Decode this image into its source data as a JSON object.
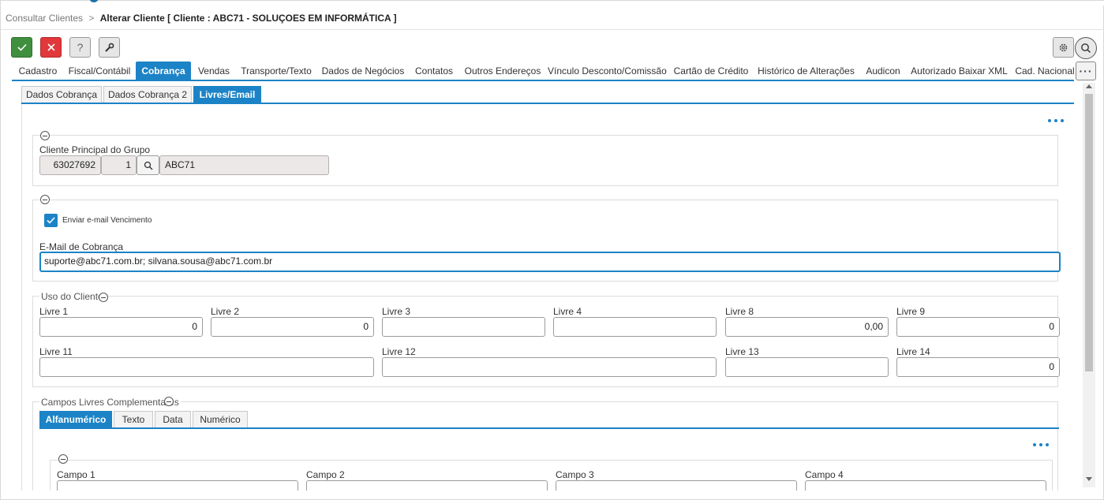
{
  "breadcrumb": {
    "parent": "Consultar Clientes",
    "separator": ">",
    "current": "Alterar Cliente [ Cliente : ABC71 - SOLUÇOES EM INFORMÁTICA ]"
  },
  "toolbar": {
    "confirm_icon": "check-icon",
    "cancel_icon": "x-icon",
    "help_label": "?",
    "tools_icon": "wrench-icon",
    "settings_icon": "gear-icon",
    "search_icon": "search-icon"
  },
  "main_tabs": [
    {
      "label": "Cadastro"
    },
    {
      "label": "Fiscal/Contábil"
    },
    {
      "label": "Cobrança",
      "active": true
    },
    {
      "label": "Vendas"
    },
    {
      "label": "Transporte/Texto"
    },
    {
      "label": "Dados de Negócios"
    },
    {
      "label": "Contatos"
    },
    {
      "label": "Outros Endereços"
    },
    {
      "label": "Vínculo Desconto/Comissão"
    },
    {
      "label": "Cartão de Crédito"
    },
    {
      "label": "Histórico de Alterações"
    },
    {
      "label": "Audicon"
    },
    {
      "label": "Autorizado Baixar XML"
    },
    {
      "label": "Cad. Nacional"
    }
  ],
  "more_tabs_label": "···",
  "sub_tabs": [
    {
      "label": "Dados Cobrança"
    },
    {
      "label": "Dados Cobrança 2"
    },
    {
      "label": "Livres/Email",
      "active": true
    }
  ],
  "grupo": {
    "label": "Cliente Principal do Grupo",
    "code": "63027692",
    "seq": "1",
    "name": "ABC71"
  },
  "email": {
    "checkbox_label": "Enviar e-mail Vencimento",
    "checked": true,
    "field_label": "E-Mail de Cobrança",
    "value": "suporte@abc71.com.br; silvana.sousa@abc71.com.br"
  },
  "uso_cliente": {
    "legend": "Uso do Cliente",
    "fields": [
      {
        "label": "Livre 1",
        "value": "0"
      },
      {
        "label": "Livre 2",
        "value": "0"
      },
      {
        "label": "Livre 3",
        "value": ""
      },
      {
        "label": "Livre 4",
        "value": ""
      },
      {
        "label": "Livre 8",
        "value": "0,00"
      },
      {
        "label": "Livre 9",
        "value": "0"
      },
      {
        "label": "Livre 11",
        "value": ""
      },
      {
        "label": "Livre 12",
        "value": ""
      },
      {
        "label": "Livre 13",
        "value": ""
      },
      {
        "label": "Livre 14",
        "value": "0"
      }
    ]
  },
  "campos_livres": {
    "legend": "Campos Livres Complementares",
    "tabs": [
      {
        "label": "Alfanumérico",
        "active": true
      },
      {
        "label": "Texto"
      },
      {
        "label": "Data"
      },
      {
        "label": "Numérico"
      }
    ],
    "fields": [
      {
        "label": "Campo 1"
      },
      {
        "label": "Campo 2"
      },
      {
        "label": "Campo 3"
      },
      {
        "label": "Campo 4"
      }
    ]
  },
  "colors": {
    "accent": "#1c83c6",
    "confirm": "#3f8f3f",
    "cancel": "#e0383b"
  }
}
